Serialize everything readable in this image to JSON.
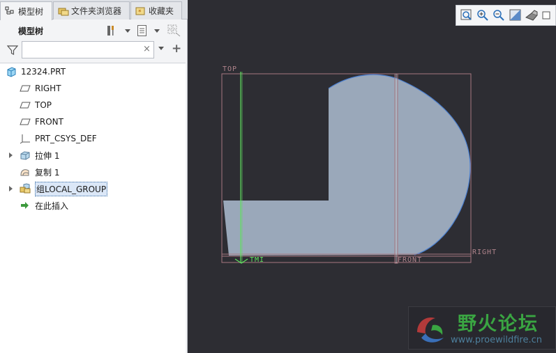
{
  "tabs": [
    {
      "label": "模型树",
      "icon": "model-tree-icon",
      "active": true
    },
    {
      "label": "文件夹浏览器",
      "icon": "folder-browser-icon",
      "active": false
    },
    {
      "label": "收藏夹",
      "icon": "favorites-icon",
      "active": false
    }
  ],
  "panel": {
    "title": "模型树"
  },
  "search": {
    "value": "",
    "clear": "×",
    "add": "+"
  },
  "tree": [
    {
      "label": "12324.PRT",
      "icon": "part-icon",
      "level": 0,
      "expandable": false,
      "selected": false
    },
    {
      "label": "RIGHT",
      "icon": "datum-plane-icon",
      "level": 1,
      "expandable": false,
      "selected": false
    },
    {
      "label": "TOP",
      "icon": "datum-plane-icon",
      "level": 1,
      "expandable": false,
      "selected": false
    },
    {
      "label": "FRONT",
      "icon": "datum-plane-icon",
      "level": 1,
      "expandable": false,
      "selected": false
    },
    {
      "label": "PRT_CSYS_DEF",
      "icon": "csys-icon",
      "level": 1,
      "expandable": false,
      "selected": false
    },
    {
      "label": "拉伸 1",
      "icon": "extrude-icon",
      "level": 1,
      "expandable": true,
      "selected": false
    },
    {
      "label": "复制 1",
      "icon": "copy-surface-icon",
      "level": 1,
      "expandable": false,
      "selected": false
    },
    {
      "label": "组LOCAL_GROUP",
      "icon": "group-icon",
      "level": 1,
      "expandable": true,
      "selected": true
    },
    {
      "label": "在此插入",
      "icon": "insert-here-icon",
      "level": 1,
      "expandable": false,
      "selected": false
    }
  ],
  "viewport": {
    "planes": {
      "top": "TOP",
      "right": "RIGHT",
      "front": "FRONT",
      "csys": "TMI"
    },
    "toolbar": [
      {
        "name": "refit-icon"
      },
      {
        "name": "zoom-in-icon"
      },
      {
        "name": "zoom-out-icon"
      },
      {
        "name": "repaint-icon"
      },
      {
        "name": "display-style-icon"
      },
      {
        "name": "saved-views-icon"
      }
    ]
  },
  "watermark": {
    "title": "野火论坛",
    "url": "www.proewildfire.cn"
  },
  "colors": {
    "background": "#2d2d33",
    "part_fill": "#9aa8ba",
    "part_edge": "#4a7fd0",
    "datum_plane": "#a87880",
    "csys_axis": "#5ee05e"
  }
}
